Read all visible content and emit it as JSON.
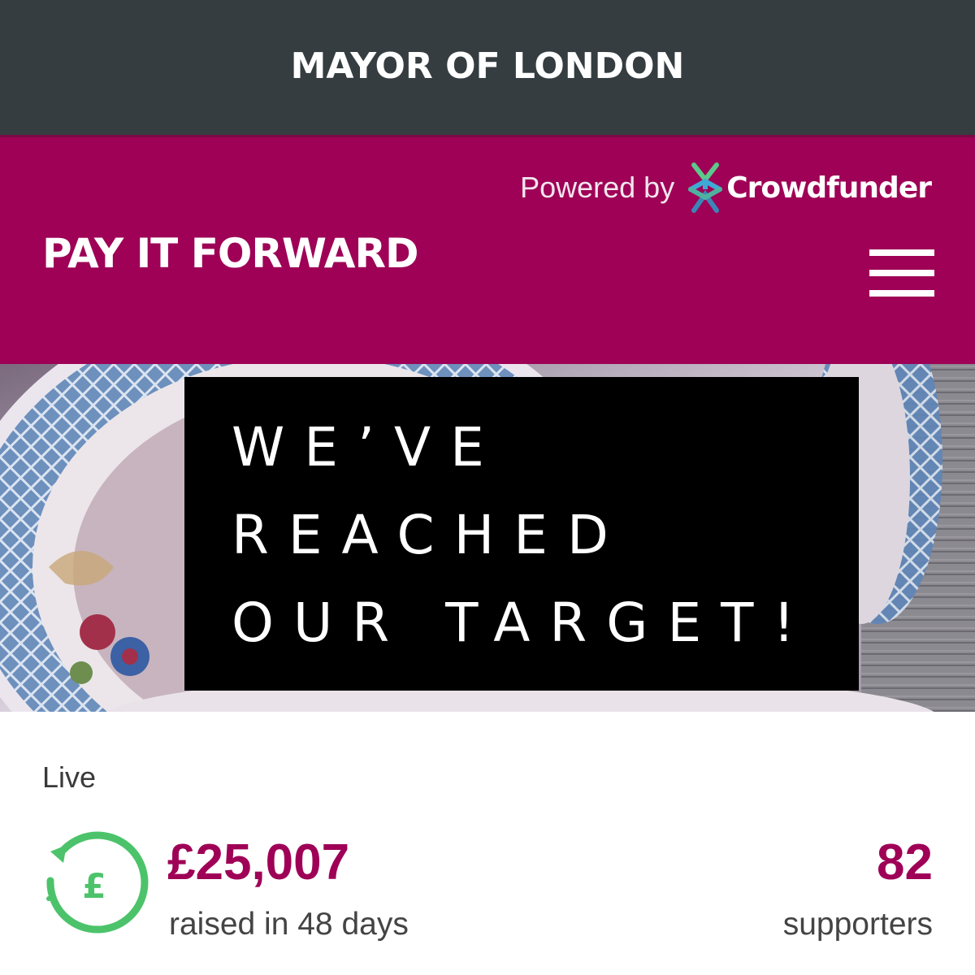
{
  "header": {
    "title": "MAYOR OF LONDON"
  },
  "brand_bar": {
    "powered_by_label": "Powered by",
    "powered_by_brand": "Crowdfunder",
    "site_name": "PAY IT FORWARD",
    "menu_icon": "hamburger-menu-icon"
  },
  "hero": {
    "lines": [
      "WE’VE",
      "REACHED",
      "OUR TARGET!"
    ]
  },
  "campaign": {
    "status": "Live",
    "amount_raised": "£25,007",
    "raised_caption": "raised in 48 days",
    "supporters_count": "82",
    "supporters_label": "supporters",
    "icon": "pound-refund-icon"
  },
  "colors": {
    "header_bg": "#353d41",
    "brand": "#9e0156",
    "icon_green": "#4cc36a"
  }
}
